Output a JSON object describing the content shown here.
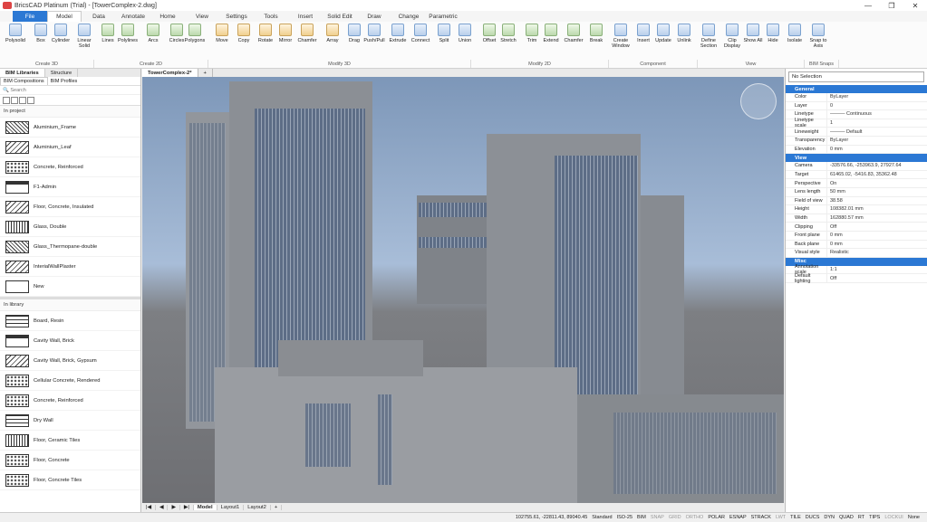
{
  "window": {
    "title": "BricsCAD Platinum (Trial) - [TowerComplex-2.dwg]",
    "min": "—",
    "max": "❐",
    "close": "✕"
  },
  "tabs": [
    "File",
    "Model",
    "Data",
    "Annotate",
    "Home",
    "View",
    "Settings",
    "Tools",
    "Insert",
    "Solid Edit",
    "Draw",
    "Change",
    "Parametric"
  ],
  "ribbon": {
    "buttons": [
      "Polysolid",
      "Box",
      "Cylinder",
      "Linear Solid",
      "Lines",
      "Polylines",
      "Arcs",
      "Circles",
      "Polygons",
      "Move",
      "Copy",
      "Rotate",
      "Mirror",
      "Chamfer",
      "Array",
      "Drag",
      "Push/Pull",
      "Extrude",
      "Connect",
      "Split",
      "Union",
      "Offset",
      "Stretch",
      "Trim",
      "Extend",
      "Chamfer",
      "Break",
      "Create Window",
      "Insert",
      "Update",
      "Unlink",
      "Define Section",
      "Clip Display",
      "Show All",
      "Hide",
      "Isolate",
      "Snap to Axis"
    ],
    "groups": [
      "Create 3D",
      "Create 2D",
      "Modify 3D",
      "Modify 2D",
      "Component",
      "View",
      "BIM Snaps"
    ]
  },
  "left": {
    "tabs": [
      "BIM Libraries",
      "Structure"
    ],
    "subtabs": [
      "BIM Compositions",
      "BIM Profiles"
    ],
    "search": "Search",
    "in_project_label": "In project",
    "in_project": [
      "Aluminium_Frame",
      "Aluminium_Leaf",
      "Concrete, Reinforced",
      "F1-Admin",
      "Floor, Concrete, Insulated",
      "Glass, Double",
      "Glass_Thermopane-double",
      "InterialWallPlaster",
      "New"
    ],
    "in_library_label": "In library",
    "in_library": [
      "Board, Resin",
      "Cavity Wall, Brick",
      "Cavity Wall, Brick, Gypsum",
      "Cellular Concrete, Rendered",
      "Concrete, Reinforced",
      "Dry Wall",
      "Floor, Ceramic Tiles",
      "Floor, Concrete",
      "Floor, Concrete Tiles"
    ]
  },
  "viewport": {
    "tab": "TowerComplex-2*",
    "plus": "+",
    "bottom_tabs": [
      "Model",
      "Layout1",
      "Layout2"
    ]
  },
  "props": {
    "selection": "No Selection",
    "general_label": "General",
    "general": [
      [
        "Color",
        "ByLayer"
      ],
      [
        "Layer",
        "0"
      ],
      [
        "Linetype",
        "——— Continuous"
      ],
      [
        "Linetype scale",
        "1"
      ],
      [
        "Lineweight",
        "——— Default"
      ],
      [
        "Transparency",
        "ByLayer"
      ],
      [
        "Elevation",
        "0 mm"
      ]
    ],
    "view_label": "View",
    "view": [
      [
        "Camera",
        "-33576.66, -253963.9, 27927.64"
      ],
      [
        "Target",
        "61465.02, -5416.83, 35362.48"
      ],
      [
        "Perspective",
        "On"
      ],
      [
        "Lens length",
        "50 mm"
      ],
      [
        "Field of view",
        "38.58"
      ],
      [
        "Height",
        "108382.01 mm"
      ],
      [
        "Width",
        "162880.57 mm"
      ],
      [
        "Clipping",
        "Off"
      ],
      [
        "Front plane",
        "0 mm"
      ],
      [
        "Back plane",
        "0 mm"
      ],
      [
        "Visual style",
        "Realistic"
      ]
    ],
    "misc_label": "Misc",
    "misc": [
      [
        "Annotation scale",
        "1:1"
      ],
      [
        "Default lighting",
        "Off"
      ]
    ]
  },
  "status": {
    "coords": "102755.61, -22811.43, 89040.45",
    "items": [
      "Standard",
      "ISO-25",
      "BIM",
      "SNAP",
      "GRID",
      "ORTHO",
      "POLAR",
      "ESNAP",
      "STRACK",
      "LWT",
      "TILE",
      "DUCS",
      "DYN",
      "QUAD",
      "RT",
      "TIPS",
      "LOCKUI",
      "None"
    ]
  }
}
